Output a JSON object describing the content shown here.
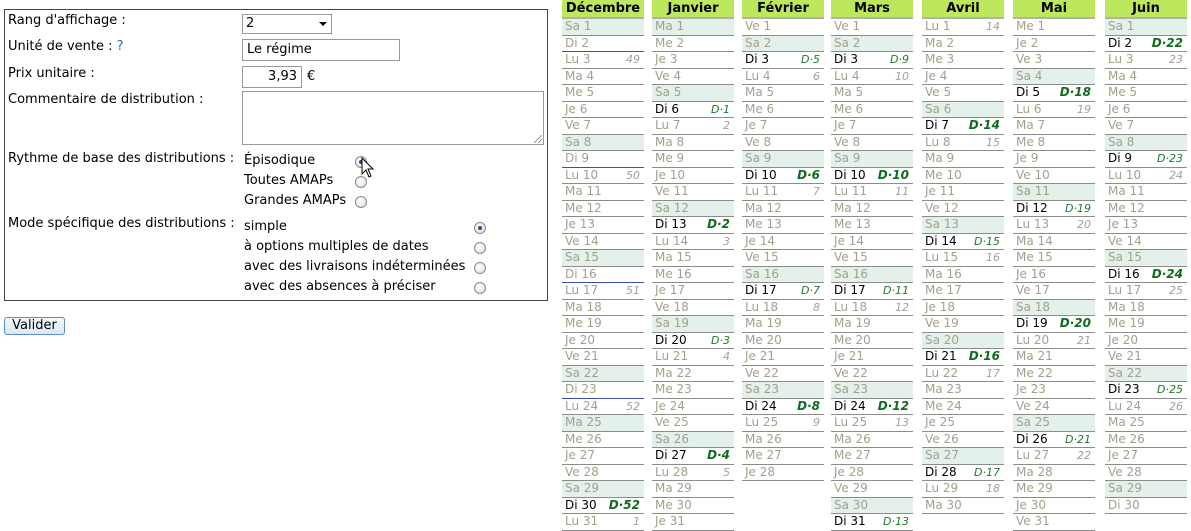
{
  "form": {
    "rank_label": "Rang d'affichage :",
    "rank_value": "2",
    "unit_label": "Unité de vente :",
    "unit_help": "?",
    "unit_value": "Le régime",
    "price_label": "Prix unitaire :",
    "price_value": "3,93",
    "price_currency": "€",
    "comment_label": "Commentaire de distribution :",
    "comment_value": "",
    "rhythm_label": "Rythme de base des distributions :",
    "rhythm_options": [
      "Épisodique",
      "Toutes AMAPs",
      "Grandes AMAPs"
    ],
    "rhythm_selected": 0,
    "mode_label": "Mode spécifique des distributions :",
    "mode_options": [
      "simple",
      "à options multiples de dates",
      "avec des livraisons indéterminées",
      "avec des absences à préciser"
    ],
    "mode_selected": 0,
    "submit_label": "Valider"
  },
  "calendar": [
    {
      "month": "Décembre",
      "rows": [
        {
          "d": "Sa 1",
          "we": true
        },
        {
          "d": "Di 2",
          "sun": true
        },
        {
          "d": "Lu 3",
          "w": "49"
        },
        {
          "d": "Ma 4"
        },
        {
          "d": "Me 5"
        },
        {
          "d": "Je 6"
        },
        {
          "d": "Ve 7"
        },
        {
          "d": "Sa 8",
          "we": true
        },
        {
          "d": "Di 9",
          "sun": true
        },
        {
          "d": "Lu 10",
          "w": "50"
        },
        {
          "d": "Ma 11"
        },
        {
          "d": "Me 12"
        },
        {
          "d": "Je 13"
        },
        {
          "d": "Ve 14"
        },
        {
          "d": "Sa 15",
          "we": true
        },
        {
          "d": "Di 16",
          "sun": true
        },
        {
          "d": "Lu 17",
          "w": "51"
        },
        {
          "d": "Ma 18"
        },
        {
          "d": "Me 19"
        },
        {
          "d": "Je 20"
        },
        {
          "d": "Ve 21"
        },
        {
          "d": "Sa 22",
          "we": true
        },
        {
          "d": "Di 23",
          "sun": true
        },
        {
          "d": "Lu 24",
          "w": "52"
        },
        {
          "d": "Ma 25",
          "we": true
        },
        {
          "d": "Me 26"
        },
        {
          "d": "Je 27"
        },
        {
          "d": "Ve 28"
        },
        {
          "d": "Sa 29",
          "we": true
        },
        {
          "d": "Di 30",
          "dist": "D·52",
          "bold": true
        },
        {
          "d": "Lu 31",
          "w": "1"
        }
      ]
    },
    {
      "month": "Janvier",
      "rows": [
        {
          "d": "Ma 1",
          "we": true
        },
        {
          "d": "Me 2"
        },
        {
          "d": "Je 3"
        },
        {
          "d": "Ve 4"
        },
        {
          "d": "Sa 5",
          "we": true
        },
        {
          "d": "Di 6",
          "dist": "D·1"
        },
        {
          "d": "Lu 7",
          "w": "2"
        },
        {
          "d": "Ma 8"
        },
        {
          "d": "Me 9"
        },
        {
          "d": "Je 10"
        },
        {
          "d": "Ve 11"
        },
        {
          "d": "Sa 12",
          "we": true
        },
        {
          "d": "Di 13",
          "dist": "D·2",
          "bold": true
        },
        {
          "d": "Lu 14",
          "w": "3"
        },
        {
          "d": "Ma 15"
        },
        {
          "d": "Me 16"
        },
        {
          "d": "Je 17"
        },
        {
          "d": "Ve 18"
        },
        {
          "d": "Sa 19",
          "we": true
        },
        {
          "d": "Di 20",
          "dist": "D·3"
        },
        {
          "d": "Lu 21",
          "w": "4"
        },
        {
          "d": "Ma 22"
        },
        {
          "d": "Me 23"
        },
        {
          "d": "Je 24"
        },
        {
          "d": "Ve 25"
        },
        {
          "d": "Sa 26",
          "we": true
        },
        {
          "d": "Di 27",
          "dist": "D·4",
          "bold": true
        },
        {
          "d": "Lu 28",
          "w": "5"
        },
        {
          "d": "Ma 29"
        },
        {
          "d": "Me 30"
        },
        {
          "d": "Je 31"
        }
      ]
    },
    {
      "month": "Février",
      "rows": [
        {
          "d": "Ve 1"
        },
        {
          "d": "Sa 2",
          "we": true
        },
        {
          "d": "Di 3",
          "dist": "D·5"
        },
        {
          "d": "Lu 4",
          "w": "6"
        },
        {
          "d": "Ma 5"
        },
        {
          "d": "Me 6"
        },
        {
          "d": "Je 7"
        },
        {
          "d": "Ve 8"
        },
        {
          "d": "Sa 9",
          "we": true
        },
        {
          "d": "Di 10",
          "dist": "D·6",
          "bold": true
        },
        {
          "d": "Lu 11",
          "w": "7"
        },
        {
          "d": "Ma 12"
        },
        {
          "d": "Me 13"
        },
        {
          "d": "Je 14"
        },
        {
          "d": "Ve 15"
        },
        {
          "d": "Sa 16",
          "we": true
        },
        {
          "d": "Di 17",
          "dist": "D·7"
        },
        {
          "d": "Lu 18",
          "w": "8"
        },
        {
          "d": "Ma 19"
        },
        {
          "d": "Me 20"
        },
        {
          "d": "Je 21"
        },
        {
          "d": "Ve 22"
        },
        {
          "d": "Sa 23",
          "we": true
        },
        {
          "d": "Di 24",
          "dist": "D·8",
          "bold": true
        },
        {
          "d": "Lu 25",
          "w": "9"
        },
        {
          "d": "Ma 26"
        },
        {
          "d": "Me 27"
        },
        {
          "d": "Je 28"
        }
      ]
    },
    {
      "month": "Mars",
      "rows": [
        {
          "d": "Ve 1"
        },
        {
          "d": "Sa 2",
          "we": true
        },
        {
          "d": "Di 3",
          "dist": "D·9"
        },
        {
          "d": "Lu 4",
          "w": "10"
        },
        {
          "d": "Ma 5"
        },
        {
          "d": "Me 6"
        },
        {
          "d": "Je 7"
        },
        {
          "d": "Ve 8"
        },
        {
          "d": "Sa 9",
          "we": true
        },
        {
          "d": "Di 10",
          "dist": "D·10",
          "bold": true
        },
        {
          "d": "Lu 11",
          "w": "11"
        },
        {
          "d": "Ma 12"
        },
        {
          "d": "Me 13"
        },
        {
          "d": "Je 14"
        },
        {
          "d": "Ve 15"
        },
        {
          "d": "Sa 16",
          "we": true
        },
        {
          "d": "Di 17",
          "dist": "D·11"
        },
        {
          "d": "Lu 18",
          "w": "12"
        },
        {
          "d": "Ma 19"
        },
        {
          "d": "Me 20"
        },
        {
          "d": "Je 21"
        },
        {
          "d": "Ve 22"
        },
        {
          "d": "Sa 23",
          "we": true
        },
        {
          "d": "Di 24",
          "dist": "D·12",
          "bold": true
        },
        {
          "d": "Lu 25",
          "w": "13"
        },
        {
          "d": "Ma 26"
        },
        {
          "d": "Me 27"
        },
        {
          "d": "Je 28"
        },
        {
          "d": "Ve 29"
        },
        {
          "d": "Sa 30",
          "we": true
        },
        {
          "d": "Di 31",
          "dist": "D·13"
        }
      ]
    },
    {
      "month": "Avril",
      "rows": [
        {
          "d": "Lu 1",
          "w": "14"
        },
        {
          "d": "Ma 2"
        },
        {
          "d": "Me 3"
        },
        {
          "d": "Je 4"
        },
        {
          "d": "Ve 5"
        },
        {
          "d": "Sa 6",
          "we": true
        },
        {
          "d": "Di 7",
          "dist": "D·14",
          "bold": true
        },
        {
          "d": "Lu 8",
          "w": "15"
        },
        {
          "d": "Ma 9"
        },
        {
          "d": "Me 10"
        },
        {
          "d": "Je 11"
        },
        {
          "d": "Ve 12"
        },
        {
          "d": "Sa 13",
          "we": true
        },
        {
          "d": "Di 14",
          "dist": "D·15"
        },
        {
          "d": "Lu 15",
          "w": "16"
        },
        {
          "d": "Ma 16"
        },
        {
          "d": "Me 17"
        },
        {
          "d": "Je 18"
        },
        {
          "d": "Ve 19"
        },
        {
          "d": "Sa 20",
          "we": true
        },
        {
          "d": "Di 21",
          "dist": "D·16",
          "bold": true
        },
        {
          "d": "Lu 22",
          "w": "17"
        },
        {
          "d": "Ma 23"
        },
        {
          "d": "Me 24"
        },
        {
          "d": "Je 25"
        },
        {
          "d": "Ve 26"
        },
        {
          "d": "Sa 27",
          "we": true
        },
        {
          "d": "Di 28",
          "dist": "D·17"
        },
        {
          "d": "Lu 29",
          "w": "18"
        },
        {
          "d": "Ma 30"
        }
      ]
    },
    {
      "month": "Mai",
      "rows": [
        {
          "d": "Me 1"
        },
        {
          "d": "Je 2"
        },
        {
          "d": "Ve 3"
        },
        {
          "d": "Sa 4",
          "we": true
        },
        {
          "d": "Di 5",
          "dist": "D·18",
          "bold": true
        },
        {
          "d": "Lu 6",
          "w": "19"
        },
        {
          "d": "Ma 7"
        },
        {
          "d": "Me 8"
        },
        {
          "d": "Je 9"
        },
        {
          "d": "Ve 10"
        },
        {
          "d": "Sa 11",
          "we": true
        },
        {
          "d": "Di 12",
          "dist": "D·19"
        },
        {
          "d": "Lu 13",
          "w": "20"
        },
        {
          "d": "Ma 14"
        },
        {
          "d": "Me 15"
        },
        {
          "d": "Je 16"
        },
        {
          "d": "Ve 17"
        },
        {
          "d": "Sa 18",
          "we": true
        },
        {
          "d": "Di 19",
          "dist": "D·20",
          "bold": true
        },
        {
          "d": "Lu 20",
          "w": "21"
        },
        {
          "d": "Ma 21"
        },
        {
          "d": "Me 22"
        },
        {
          "d": "Je 23"
        },
        {
          "d": "Ve 24"
        },
        {
          "d": "Sa 25",
          "we": true
        },
        {
          "d": "Di 26",
          "dist": "D·21"
        },
        {
          "d": "Lu 27",
          "w": "22"
        },
        {
          "d": "Ma 28"
        },
        {
          "d": "Me 29"
        },
        {
          "d": "Je 30"
        },
        {
          "d": "Ve 31"
        }
      ]
    },
    {
      "month": "Juin",
      "rows": [
        {
          "d": "Sa 1",
          "we": true
        },
        {
          "d": "Di 2",
          "dist": "D·22",
          "bold": true
        },
        {
          "d": "Lu 3",
          "w": "23"
        },
        {
          "d": "Ma 4"
        },
        {
          "d": "Me 5"
        },
        {
          "d": "Je 6"
        },
        {
          "d": "Ve 7"
        },
        {
          "d": "Sa 8",
          "we": true
        },
        {
          "d": "Di 9",
          "dist": "D·23"
        },
        {
          "d": "Lu 10",
          "w": "24"
        },
        {
          "d": "Ma 11"
        },
        {
          "d": "Me 12"
        },
        {
          "d": "Je 13"
        },
        {
          "d": "Ve 14"
        },
        {
          "d": "Sa 15",
          "we": true
        },
        {
          "d": "Di 16",
          "dist": "D·24",
          "bold": true
        },
        {
          "d": "Lu 17",
          "w": "25"
        },
        {
          "d": "Ma 18"
        },
        {
          "d": "Me 19"
        },
        {
          "d": "Je 20"
        },
        {
          "d": "Ve 21"
        },
        {
          "d": "Sa 22",
          "we": true
        },
        {
          "d": "Di 23",
          "dist": "D·25"
        },
        {
          "d": "Lu 24",
          "w": "26"
        },
        {
          "d": "Ma 25"
        },
        {
          "d": "Me 26"
        },
        {
          "d": "Je 27"
        },
        {
          "d": "Ve 28"
        },
        {
          "d": "Sa 29",
          "we": true
        },
        {
          "d": "Di 30"
        }
      ]
    }
  ]
}
